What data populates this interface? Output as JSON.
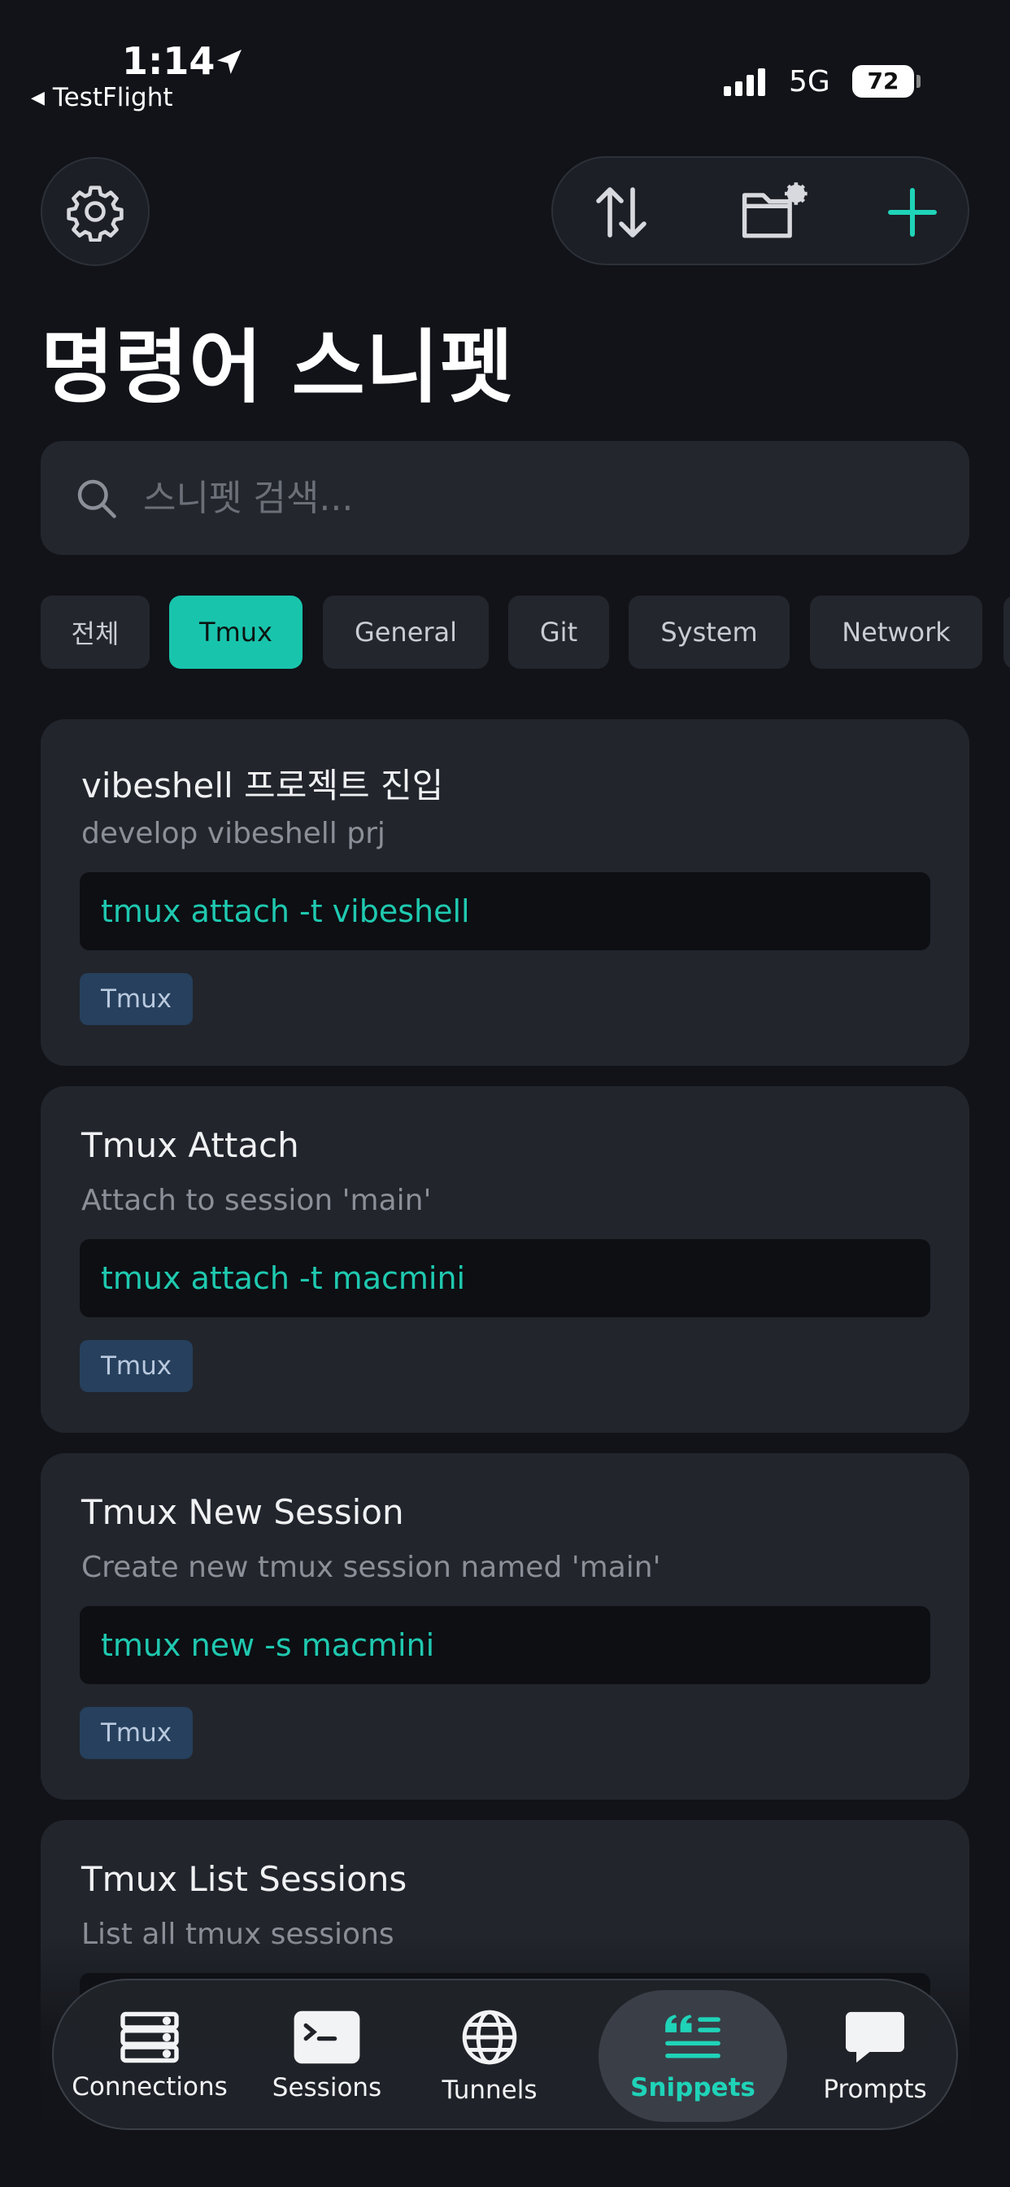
{
  "status_bar": {
    "time": "1:14",
    "back_app": "TestFlight",
    "network": "5G",
    "battery": "72"
  },
  "header": {
    "title": "명령어 스니펫",
    "icons": [
      "gear-icon",
      "sort-icon",
      "folder-settings-icon",
      "plus-icon"
    ]
  },
  "search": {
    "placeholder": "스니펫 검색..."
  },
  "filters": [
    "전체",
    "Tmux",
    "General",
    "Git",
    "System",
    "Network"
  ],
  "selected_filter": "Tmux",
  "snippets": [
    {
      "title": "vibeshell 프로젝트 진입",
      "description": "develop vibeshell prj",
      "command": "tmux attach -t vibeshell",
      "tag": "Tmux"
    },
    {
      "title": "Tmux Attach",
      "description": "Attach to session 'main'",
      "command": "tmux attach -t macmini",
      "tag": "Tmux"
    },
    {
      "title": "Tmux New Session",
      "description": "Create new tmux session named 'main'",
      "command": "tmux new -s macmini",
      "tag": "Tmux"
    },
    {
      "title": "Tmux List Sessions",
      "description": "List all tmux sessions",
      "command": "",
      "tag": ""
    }
  ],
  "tabs": [
    {
      "label": "Connections",
      "icon": "server-icon"
    },
    {
      "label": "Sessions",
      "icon": "terminal-icon"
    },
    {
      "label": "Tunnels",
      "icon": "globe-icon"
    },
    {
      "label": "Snippets",
      "icon": "quote-list-icon"
    },
    {
      "label": "Prompts",
      "icon": "chat-bubble-icon"
    }
  ],
  "active_tab": "Snippets",
  "colors": {
    "background": "#111318",
    "card": "#22252c",
    "accent": "#19c4ad",
    "tag_bg": "#26405d"
  }
}
